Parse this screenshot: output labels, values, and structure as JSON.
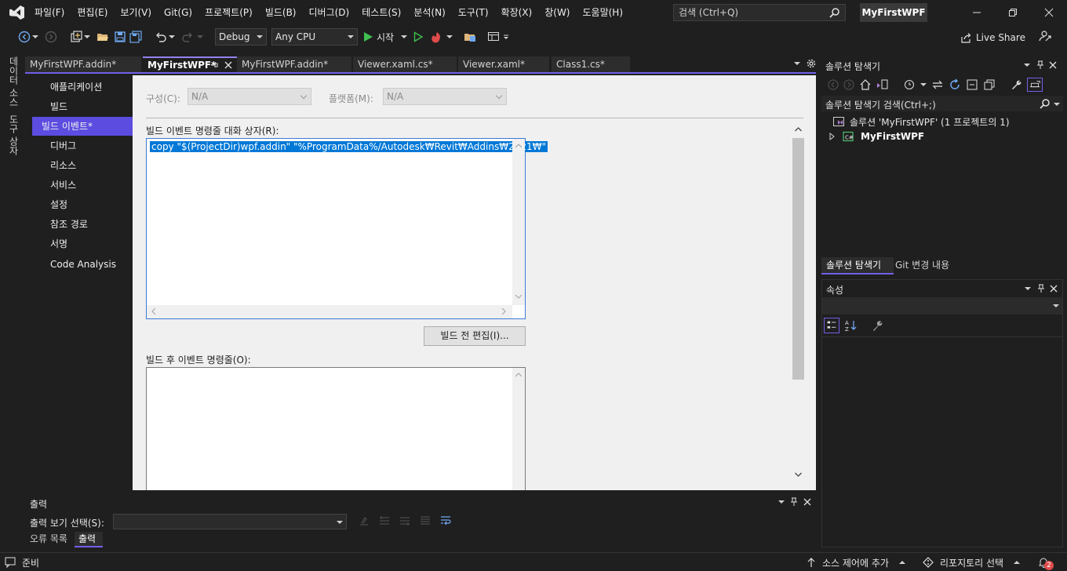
{
  "menu": {
    "items": [
      "파일(F)",
      "편집(E)",
      "보기(V)",
      "Git(G)",
      "프로젝트(P)",
      "빌드(B)",
      "디버그(D)",
      "테스트(S)",
      "분석(N)",
      "도구(T)",
      "확장(X)",
      "창(W)",
      "도움말(H)"
    ],
    "search_placeholder": "검색 (Ctrl+Q)",
    "solution_title": "MyFirstWPF"
  },
  "toolbar": {
    "config": "Debug",
    "platform": "Any CPU",
    "start_label": "시작",
    "live_share": "Live Share"
  },
  "left_strip": {
    "data_sources": "데이터 소스",
    "toolbox": "도구 상자"
  },
  "doc_tabs": [
    {
      "label": "MyFirstWPF.addin*",
      "active": false
    },
    {
      "label": "MyFirstWPF*",
      "active": true
    },
    {
      "label": "MyFirstWPF.addin*",
      "active": false
    },
    {
      "label": "Viewer.xaml.cs*",
      "active": false
    },
    {
      "label": "Viewer.xaml*",
      "active": false
    },
    {
      "label": "Class1.cs*",
      "active": false
    }
  ],
  "project_nav": {
    "items": [
      "애플리케이션",
      "빌드",
      "빌드 이벤트*",
      "디버그",
      "리소스",
      "서비스",
      "설정",
      "참조 경로",
      "서명",
      "Code Analysis"
    ],
    "active_index": 2
  },
  "build_events": {
    "config_label": "구성(C):",
    "config_value": "N/A",
    "platform_label": "플랫폼(M):",
    "platform_value": "N/A",
    "prebuild_label": "빌드 이벤트 명령줄 대화 상자(R):",
    "prebuild_command": "copy \"$(ProjectDir)wpf.addin\" \"%ProgramData%/Autodesk₩Revit₩Addins₩2021₩\"",
    "edit_prebuild_button": "빌드 전 편집(I)...",
    "postbuild_label": "빌드 후 이벤트 명령줄(O):",
    "postbuild_command": ""
  },
  "solution_explorer": {
    "title": "솔루션 탐색기",
    "search_placeholder": "솔루션 탐색기 검색(Ctrl+;)",
    "solution_node": "솔루션 'MyFirstWPF' (1 프로젝트의 1)",
    "project_node": "MyFirstWPF",
    "tabs": [
      "솔루션 탐색기",
      "Git 변경 내용"
    ]
  },
  "properties": {
    "title": "속성"
  },
  "output": {
    "title": "출력",
    "show_from_label": "출력 보기 선택(S):",
    "tabs": [
      "오류 목록",
      "출력"
    ]
  },
  "status": {
    "ready": "준비",
    "add_source_control": "소스 제어에 추가",
    "select_repo": "리포지토리 선택",
    "notification_count": "2"
  },
  "colors": {
    "accent": "#7160e8",
    "nav_active": "#5c4ce0",
    "selection": "#0078d7"
  }
}
